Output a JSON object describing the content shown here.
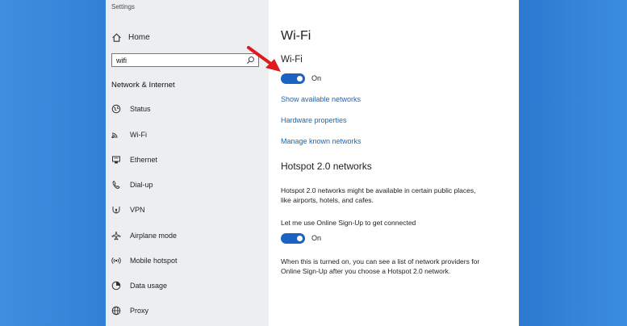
{
  "window": {
    "title": "Settings"
  },
  "sidebar": {
    "home_label": "Home",
    "search": {
      "value": "wifi"
    },
    "section_title": "Network & Internet",
    "items": [
      {
        "label": "Status",
        "icon": "globe-icon"
      },
      {
        "label": "Wi-Fi",
        "icon": "wifi-icon"
      },
      {
        "label": "Ethernet",
        "icon": "ethernet-icon"
      },
      {
        "label": "Dial-up",
        "icon": "phone-icon"
      },
      {
        "label": "VPN",
        "icon": "vpn-icon"
      },
      {
        "label": "Airplane mode",
        "icon": "airplane-icon"
      },
      {
        "label": "Mobile hotspot",
        "icon": "hotspot-icon"
      },
      {
        "label": "Data usage",
        "icon": "data-usage-icon"
      },
      {
        "label": "Proxy",
        "icon": "globe-icon"
      }
    ]
  },
  "main": {
    "page_title": "Wi-Fi",
    "wifi_label": "Wi-Fi",
    "wifi_state": "On",
    "links": [
      "Show available networks",
      "Hardware properties",
      "Manage known networks"
    ],
    "hotspot_heading": "Hotspot 2.0 networks",
    "hotspot_desc_1": "Hotspot 2.0 networks might be available in certain public places,",
    "hotspot_desc_2": "like airports, hotels, and cafes.",
    "signup_label": "Let me use Online Sign-Up to get connected",
    "signup_state": "On",
    "signup_desc_1": "When this is turned on, you can see a list of network providers for",
    "signup_desc_2": "Online Sign-Up after you choose a Hotspot 2.0 network."
  },
  "colors": {
    "accent": "#1a63c2",
    "link": "#1c66b4",
    "annotation": "#e0191f",
    "desktop": "#2f7fd4"
  }
}
